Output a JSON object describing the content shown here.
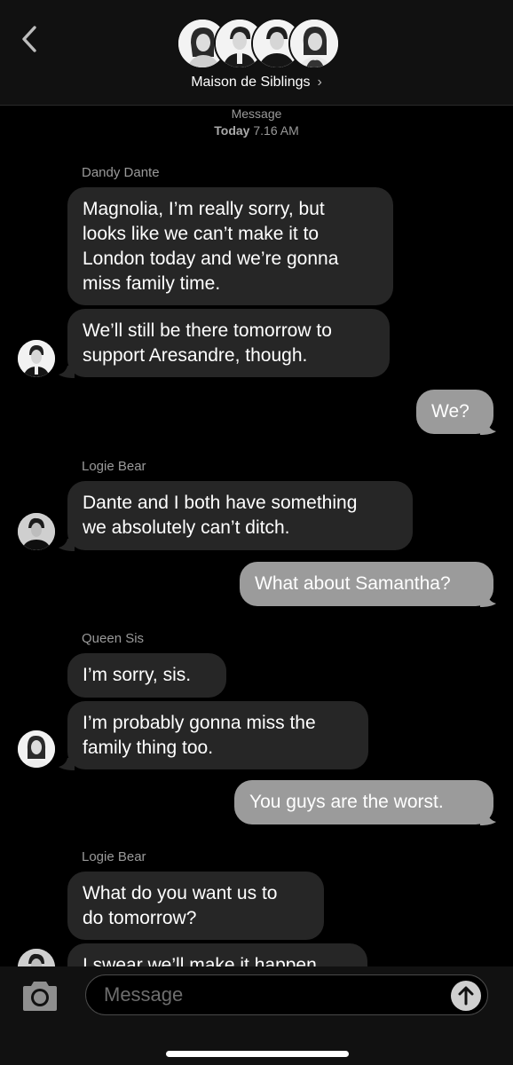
{
  "header": {
    "group_name": "Maison de Siblings",
    "chevron": "›",
    "icons": {
      "back": "chevron-left-icon",
      "group": "group-avatars"
    }
  },
  "timestamp": {
    "label": "Message",
    "day": "Today",
    "time": "7.16 AM"
  },
  "messages": [
    {
      "sender": "Dandy Dante",
      "text": "Magnolia, I’m really sorry, but\nlooks like we can’t make it to\nLondon today and we’re gonna\nmiss family time."
    },
    {
      "text": "We’ll still be there tomorrow to\nsupport Aresandre, though."
    },
    {
      "text": "We?"
    },
    {
      "sender": "Logie Bear",
      "text": "Dante and I both have something\nwe absolutely can’t ditch."
    },
    {
      "text": "What about Samantha?"
    },
    {
      "sender": "Queen Sis",
      "text": "I’m sorry, sis."
    },
    {
      "text": "I’m probably gonna miss the\nfamily thing too."
    },
    {
      "text": "You guys are the worst."
    },
    {
      "sender": "Logie Bear",
      "text": "What do you want us to\ndo tomorrow?"
    },
    {
      "text": "I swear we’ll make it happen."
    }
  ],
  "composer": {
    "placeholder": "Message",
    "icons": {
      "camera": "camera-icon",
      "send": "send-arrow-icon"
    }
  },
  "colors": {
    "incoming": "#262626",
    "outgoing": "#9b9b9b",
    "background": "#000000"
  }
}
